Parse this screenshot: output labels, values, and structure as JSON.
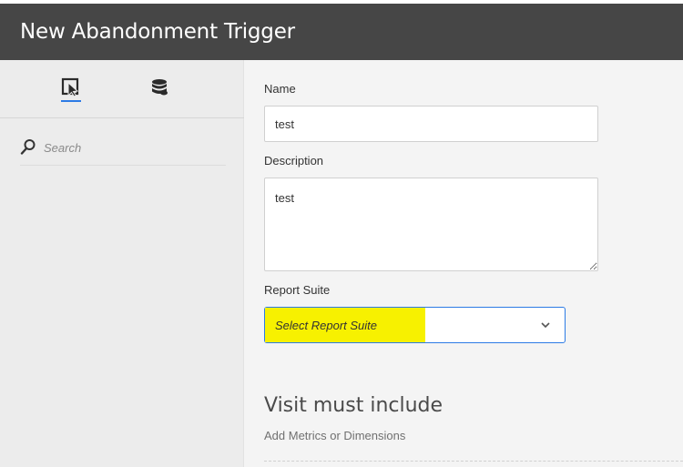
{
  "header": {
    "title": "New Abandonment Trigger"
  },
  "sidebar": {
    "tabs": [
      {
        "name": "components",
        "icon": "cursor-select-icon",
        "active": true
      },
      {
        "name": "data",
        "icon": "database-icon",
        "active": false
      }
    ],
    "search": {
      "placeholder": "Search",
      "icon": "search-icon"
    }
  },
  "form": {
    "name_label": "Name",
    "name_value": "test",
    "description_label": "Description",
    "description_value": "test",
    "report_suite_label": "Report Suite",
    "report_suite_value": "Select Report Suite",
    "highlight_color": "#f7f100",
    "accent_color": "#2c7be5"
  },
  "visit": {
    "title": "Visit must include",
    "subtitle": "Add Metrics or Dimensions"
  }
}
